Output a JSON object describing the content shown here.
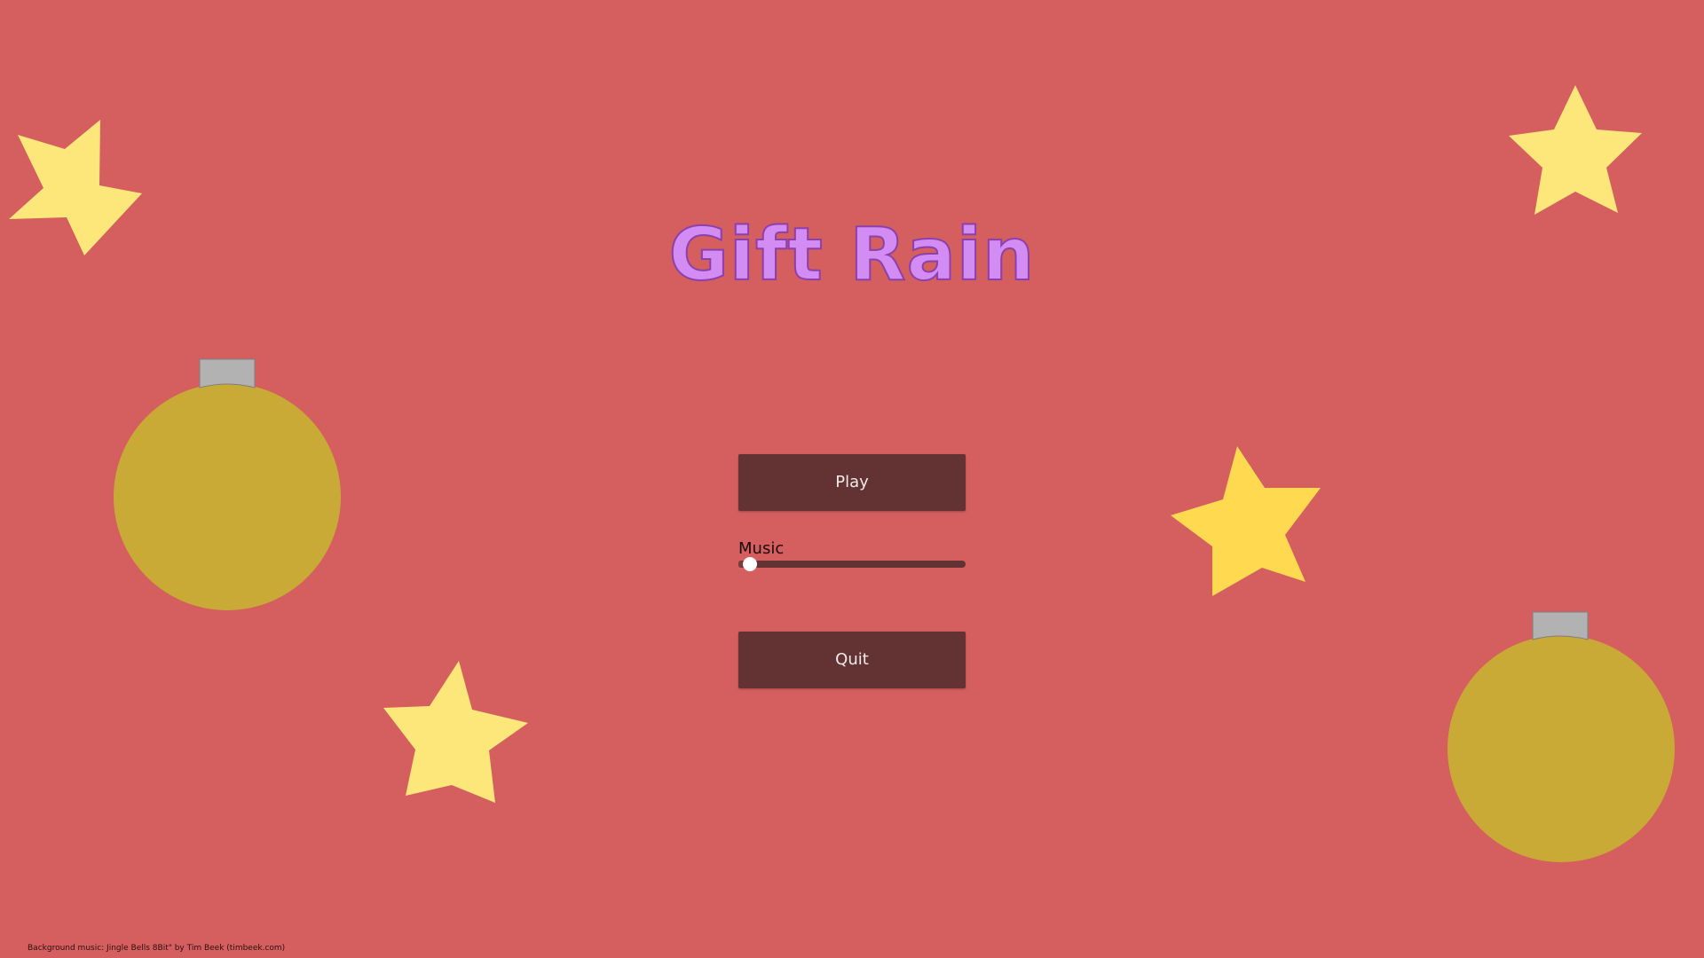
{
  "game": {
    "title": "Gift Rain"
  },
  "menu": {
    "play_label": "Play",
    "music_label": "Music",
    "music_volume": 0.02,
    "quit_label": "Quit"
  },
  "footer": {
    "credit": "Background music: Jingle Bells 8Bit\" by Tim Beek (timbeek.com)"
  },
  "colors": {
    "background": "#d45f5e",
    "star_light": "#fee77a",
    "star_bright": "#ffd94f",
    "ornament": "#c9aa36",
    "ornament_cap": "#b2b2b2",
    "button": "#633233",
    "title_fill": "#d38cf3",
    "title_outline": "#8d3fae"
  },
  "decorations": {
    "stars": [
      "star-icon",
      "star-icon",
      "star-icon",
      "star-icon"
    ],
    "ornaments": [
      "ornament-icon",
      "ornament-icon"
    ]
  }
}
